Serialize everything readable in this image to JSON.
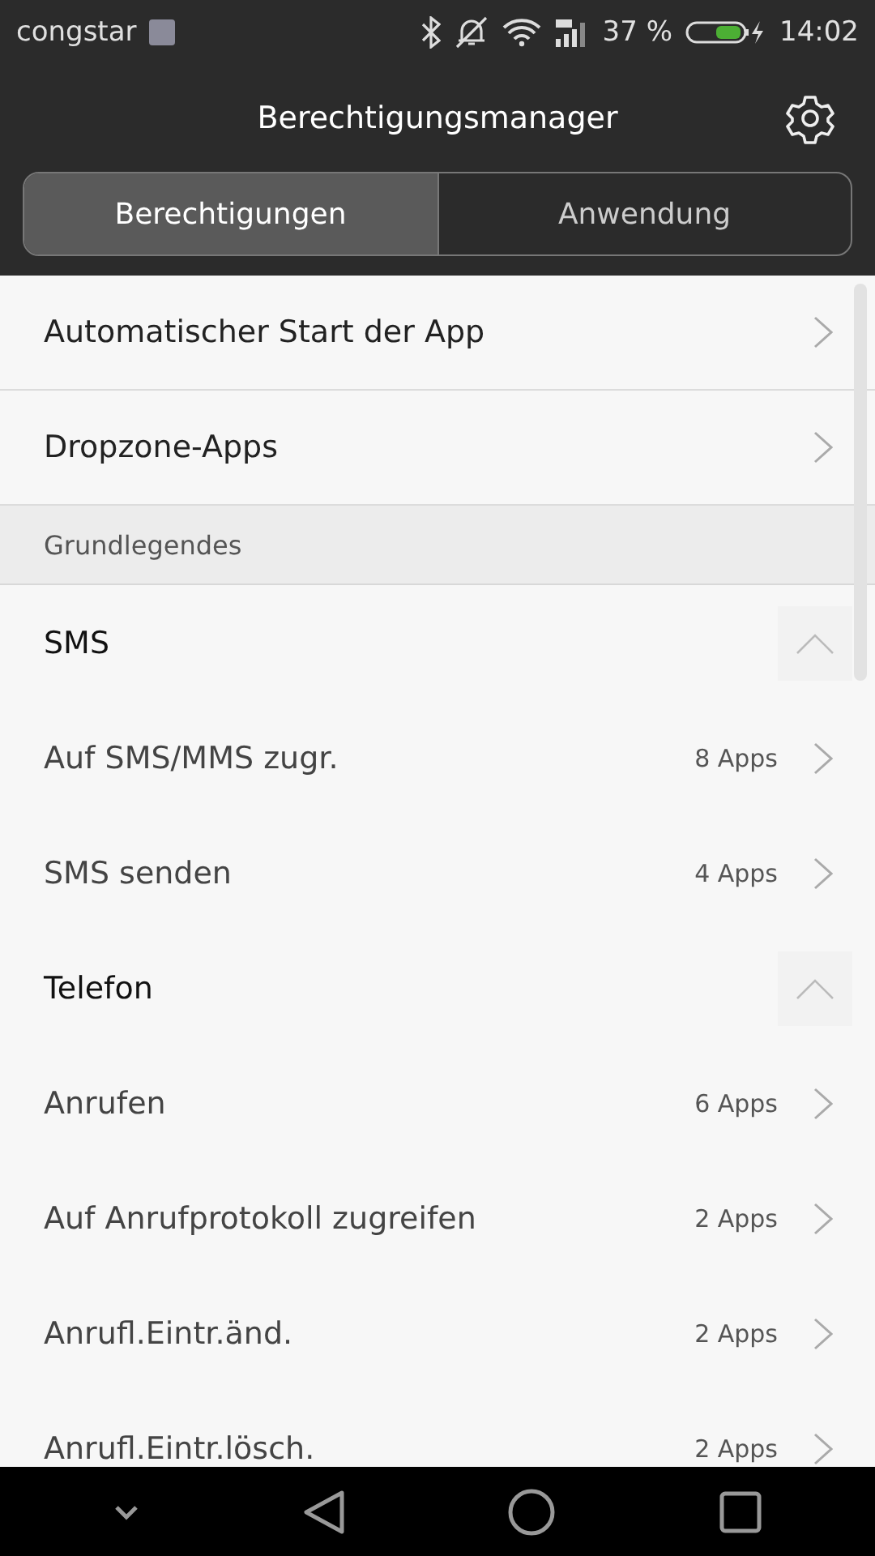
{
  "status_bar": {
    "carrier": "congstar",
    "battery": "37 %",
    "time": "14:02"
  },
  "header": {
    "title": "Berechtigungsmanager"
  },
  "tabs": [
    {
      "label": "Berechtigungen",
      "selected": true
    },
    {
      "label": "Anwendung",
      "selected": false
    }
  ],
  "list": [
    {
      "kind": "link",
      "label": "Automatischer Start der App"
    },
    {
      "kind": "link",
      "label": "Dropzone-Apps"
    },
    {
      "kind": "section",
      "label": "Grundlegendes"
    },
    {
      "kind": "group",
      "label": "SMS",
      "expanded": true
    },
    {
      "kind": "permission",
      "label": "Auf SMS/MMS zugr.",
      "count": "8 Apps"
    },
    {
      "kind": "permission",
      "label": "SMS senden",
      "count": "4 Apps"
    },
    {
      "kind": "group",
      "label": "Telefon",
      "expanded": true
    },
    {
      "kind": "permission",
      "label": "Anrufen",
      "count": "6 Apps"
    },
    {
      "kind": "permission",
      "label": "Auf Anrufprotokoll zugreifen",
      "count": "2 Apps"
    },
    {
      "kind": "permission",
      "label": "Anrufl.Eintr.änd.",
      "count": "2 Apps"
    },
    {
      "kind": "permission",
      "label": "Anrufl.Eintr.lösch.",
      "count": "2 Apps"
    }
  ]
}
